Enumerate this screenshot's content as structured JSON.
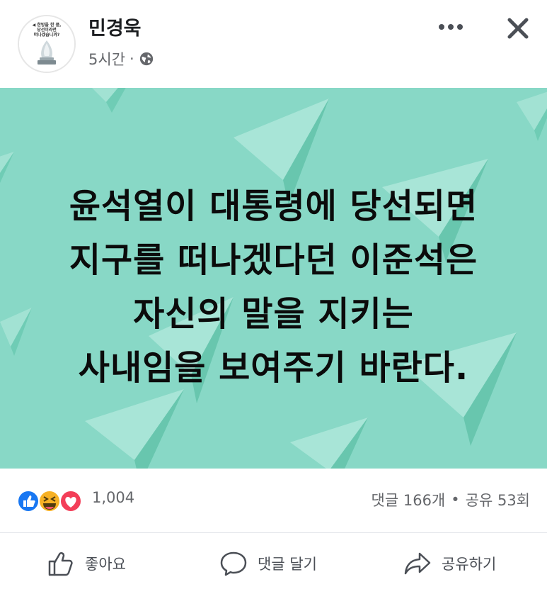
{
  "post": {
    "author": "민경욱",
    "time": "5시간",
    "separator": "·",
    "avatar": {
      "lines": [
        "◀ 한방을 한 품,",
        "당선이라면",
        "떠나겠습니까?"
      ]
    },
    "image_text": [
      "윤석열이 대통령에 당선되면",
      "지구를 떠나겠다던 이준석은",
      "자신의 말을 지키는",
      "사내임을 보여주기 바란다."
    ],
    "image_bg_color": "#88d8c6"
  },
  "reactions": {
    "icons": [
      "like-icon",
      "haha-icon",
      "love-icon"
    ],
    "count": "1,004"
  },
  "stats": {
    "comments": "댓글 166개",
    "separator": "•",
    "shares": "공유 53회"
  },
  "actions": {
    "like": "좋아요",
    "comment": "댓글 달기",
    "share": "공유하기"
  },
  "icons": {
    "more": "more-icon",
    "close": "close-icon",
    "privacy": "globe-icon"
  }
}
